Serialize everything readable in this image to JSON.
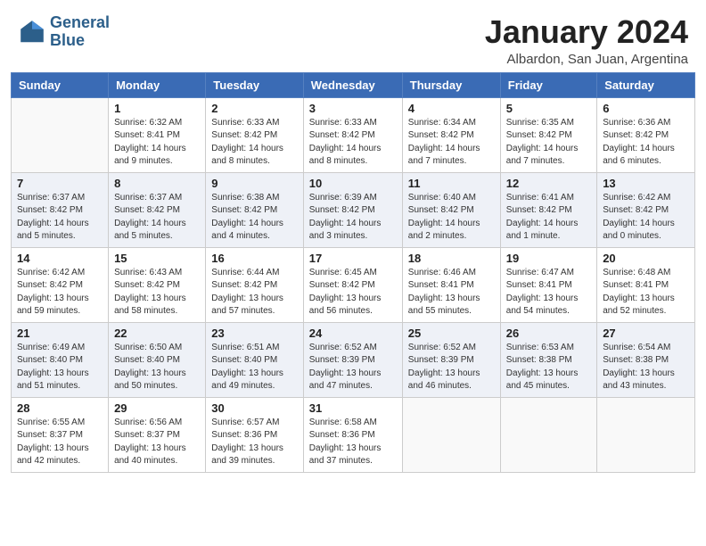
{
  "header": {
    "logo_line1": "General",
    "logo_line2": "Blue",
    "month_title": "January 2024",
    "location": "Albardon, San Juan, Argentina"
  },
  "weekdays": [
    "Sunday",
    "Monday",
    "Tuesday",
    "Wednesday",
    "Thursday",
    "Friday",
    "Saturday"
  ],
  "weeks": [
    [
      {
        "day": "",
        "info": ""
      },
      {
        "day": "1",
        "info": "Sunrise: 6:32 AM\nSunset: 8:41 PM\nDaylight: 14 hours\nand 9 minutes."
      },
      {
        "day": "2",
        "info": "Sunrise: 6:33 AM\nSunset: 8:42 PM\nDaylight: 14 hours\nand 8 minutes."
      },
      {
        "day": "3",
        "info": "Sunrise: 6:33 AM\nSunset: 8:42 PM\nDaylight: 14 hours\nand 8 minutes."
      },
      {
        "day": "4",
        "info": "Sunrise: 6:34 AM\nSunset: 8:42 PM\nDaylight: 14 hours\nand 7 minutes."
      },
      {
        "day": "5",
        "info": "Sunrise: 6:35 AM\nSunset: 8:42 PM\nDaylight: 14 hours\nand 7 minutes."
      },
      {
        "day": "6",
        "info": "Sunrise: 6:36 AM\nSunset: 8:42 PM\nDaylight: 14 hours\nand 6 minutes."
      }
    ],
    [
      {
        "day": "7",
        "info": "Sunrise: 6:37 AM\nSunset: 8:42 PM\nDaylight: 14 hours\nand 5 minutes."
      },
      {
        "day": "8",
        "info": "Sunrise: 6:37 AM\nSunset: 8:42 PM\nDaylight: 14 hours\nand 5 minutes."
      },
      {
        "day": "9",
        "info": "Sunrise: 6:38 AM\nSunset: 8:42 PM\nDaylight: 14 hours\nand 4 minutes."
      },
      {
        "day": "10",
        "info": "Sunrise: 6:39 AM\nSunset: 8:42 PM\nDaylight: 14 hours\nand 3 minutes."
      },
      {
        "day": "11",
        "info": "Sunrise: 6:40 AM\nSunset: 8:42 PM\nDaylight: 14 hours\nand 2 minutes."
      },
      {
        "day": "12",
        "info": "Sunrise: 6:41 AM\nSunset: 8:42 PM\nDaylight: 14 hours\nand 1 minute."
      },
      {
        "day": "13",
        "info": "Sunrise: 6:42 AM\nSunset: 8:42 PM\nDaylight: 14 hours\nand 0 minutes."
      }
    ],
    [
      {
        "day": "14",
        "info": "Sunrise: 6:42 AM\nSunset: 8:42 PM\nDaylight: 13 hours\nand 59 minutes."
      },
      {
        "day": "15",
        "info": "Sunrise: 6:43 AM\nSunset: 8:42 PM\nDaylight: 13 hours\nand 58 minutes."
      },
      {
        "day": "16",
        "info": "Sunrise: 6:44 AM\nSunset: 8:42 PM\nDaylight: 13 hours\nand 57 minutes."
      },
      {
        "day": "17",
        "info": "Sunrise: 6:45 AM\nSunset: 8:42 PM\nDaylight: 13 hours\nand 56 minutes."
      },
      {
        "day": "18",
        "info": "Sunrise: 6:46 AM\nSunset: 8:41 PM\nDaylight: 13 hours\nand 55 minutes."
      },
      {
        "day": "19",
        "info": "Sunrise: 6:47 AM\nSunset: 8:41 PM\nDaylight: 13 hours\nand 54 minutes."
      },
      {
        "day": "20",
        "info": "Sunrise: 6:48 AM\nSunset: 8:41 PM\nDaylight: 13 hours\nand 52 minutes."
      }
    ],
    [
      {
        "day": "21",
        "info": "Sunrise: 6:49 AM\nSunset: 8:40 PM\nDaylight: 13 hours\nand 51 minutes."
      },
      {
        "day": "22",
        "info": "Sunrise: 6:50 AM\nSunset: 8:40 PM\nDaylight: 13 hours\nand 50 minutes."
      },
      {
        "day": "23",
        "info": "Sunrise: 6:51 AM\nSunset: 8:40 PM\nDaylight: 13 hours\nand 49 minutes."
      },
      {
        "day": "24",
        "info": "Sunrise: 6:52 AM\nSunset: 8:39 PM\nDaylight: 13 hours\nand 47 minutes."
      },
      {
        "day": "25",
        "info": "Sunrise: 6:52 AM\nSunset: 8:39 PM\nDaylight: 13 hours\nand 46 minutes."
      },
      {
        "day": "26",
        "info": "Sunrise: 6:53 AM\nSunset: 8:38 PM\nDaylight: 13 hours\nand 45 minutes."
      },
      {
        "day": "27",
        "info": "Sunrise: 6:54 AM\nSunset: 8:38 PM\nDaylight: 13 hours\nand 43 minutes."
      }
    ],
    [
      {
        "day": "28",
        "info": "Sunrise: 6:55 AM\nSunset: 8:37 PM\nDaylight: 13 hours\nand 42 minutes."
      },
      {
        "day": "29",
        "info": "Sunrise: 6:56 AM\nSunset: 8:37 PM\nDaylight: 13 hours\nand 40 minutes."
      },
      {
        "day": "30",
        "info": "Sunrise: 6:57 AM\nSunset: 8:36 PM\nDaylight: 13 hours\nand 39 minutes."
      },
      {
        "day": "31",
        "info": "Sunrise: 6:58 AM\nSunset: 8:36 PM\nDaylight: 13 hours\nand 37 minutes."
      },
      {
        "day": "",
        "info": ""
      },
      {
        "day": "",
        "info": ""
      },
      {
        "day": "",
        "info": ""
      }
    ]
  ]
}
